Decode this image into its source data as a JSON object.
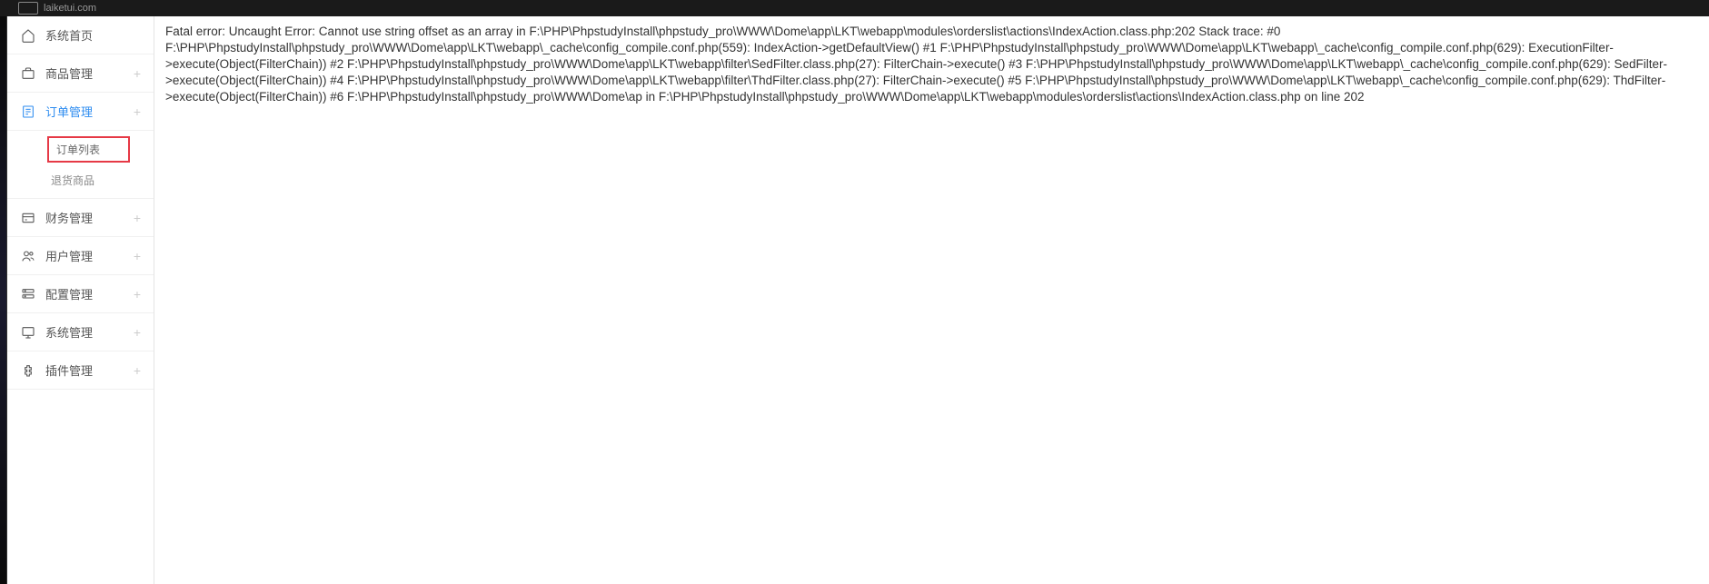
{
  "brand": {
    "name": "laiketui.com"
  },
  "sidebar": {
    "items": [
      {
        "label": "系统首页",
        "icon": "home",
        "expandable": false
      },
      {
        "label": "商品管理",
        "icon": "product",
        "expandable": true
      },
      {
        "label": "订单管理",
        "icon": "order",
        "expandable": true,
        "active": true,
        "children": [
          {
            "label": "订单列表",
            "active": true
          },
          {
            "label": "退货商品",
            "active": false
          }
        ]
      },
      {
        "label": "财务管理",
        "icon": "finance",
        "expandable": true
      },
      {
        "label": "用户管理",
        "icon": "user",
        "expandable": true
      },
      {
        "label": "配置管理",
        "icon": "config",
        "expandable": true
      },
      {
        "label": "系统管理",
        "icon": "system",
        "expandable": true
      },
      {
        "label": "插件管理",
        "icon": "plugin",
        "expandable": true
      }
    ]
  },
  "content": {
    "error_text": "Fatal error: Uncaught Error: Cannot use string offset as an array in F:\\PHP\\PhpstudyInstall\\phpstudy_pro\\WWW\\Dome\\app\\LKT\\webapp\\modules\\orderslist\\actions\\IndexAction.class.php:202 Stack trace: #0 F:\\PHP\\PhpstudyInstall\\phpstudy_pro\\WWW\\Dome\\app\\LKT\\webapp\\_cache\\config_compile.conf.php(559): IndexAction->getDefaultView() #1 F:\\PHP\\PhpstudyInstall\\phpstudy_pro\\WWW\\Dome\\app\\LKT\\webapp\\_cache\\config_compile.conf.php(629): ExecutionFilter->execute(Object(FilterChain)) #2 F:\\PHP\\PhpstudyInstall\\phpstudy_pro\\WWW\\Dome\\app\\LKT\\webapp\\filter\\SedFilter.class.php(27): FilterChain->execute() #3 F:\\PHP\\PhpstudyInstall\\phpstudy_pro\\WWW\\Dome\\app\\LKT\\webapp\\_cache\\config_compile.conf.php(629): SedFilter->execute(Object(FilterChain)) #4 F:\\PHP\\PhpstudyInstall\\phpstudy_pro\\WWW\\Dome\\app\\LKT\\webapp\\filter\\ThdFilter.class.php(27): FilterChain->execute() #5 F:\\PHP\\PhpstudyInstall\\phpstudy_pro\\WWW\\Dome\\app\\LKT\\webapp\\_cache\\config_compile.conf.php(629): ThdFilter->execute(Object(FilterChain)) #6 F:\\PHP\\PhpstudyInstall\\phpstudy_pro\\WWW\\Dome\\ap in F:\\PHP\\PhpstudyInstall\\phpstudy_pro\\WWW\\Dome\\app\\LKT\\webapp\\modules\\orderslist\\actions\\IndexAction.class.php on line 202"
  },
  "plus_symbol": "+"
}
